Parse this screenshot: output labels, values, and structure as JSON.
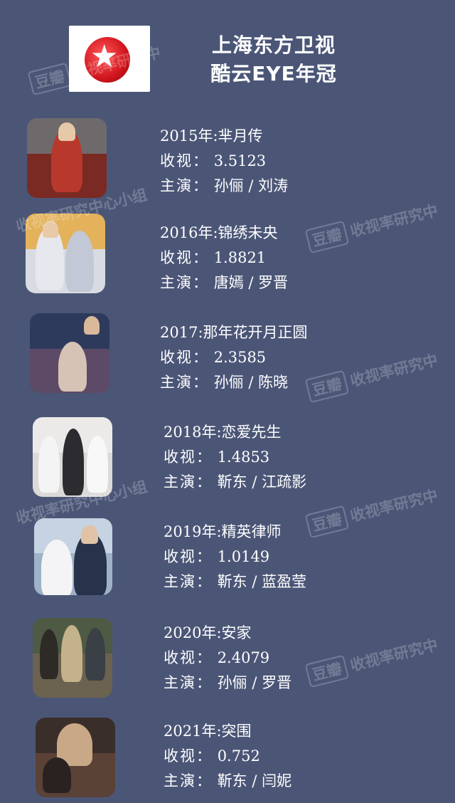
{
  "header": {
    "line1": "上海东方卫视",
    "line2": "酷云EYE年冠"
  },
  "watermark": {
    "badge": "豆瓣",
    "text": "收视率研究中",
    "text_full": "收视率研究中心小组"
  },
  "entries": [
    {
      "title": "2015年:芈月传",
      "rating_label": "收视：",
      "rating": "3.5123",
      "cast_label": "主演：",
      "cast": "孙俪 / 刘涛"
    },
    {
      "title": "2016年:锦绣未央",
      "rating_label": "收视：",
      "rating": "1.8821",
      "cast_label": "主演：",
      "cast": "唐嫣 / 罗晋"
    },
    {
      "title": "2017:那年花开月正圆",
      "rating_label": "收视：",
      "rating": "2.3585",
      "cast_label": "主演：",
      "cast": "孙俪 / 陈晓"
    },
    {
      "title": "2018年:恋爱先生",
      "rating_label": "收视：",
      "rating": "1.4853",
      "cast_label": "主演：",
      "cast": "靳东 / 江疏影"
    },
    {
      "title": "2019年:精英律师",
      "rating_label": "收视：",
      "rating": "1.0149",
      "cast_label": "主演：",
      "cast": "靳东 / 蓝盈莹"
    },
    {
      "title": "2020年:安家",
      "rating_label": "收视：",
      "rating": "2.4079",
      "cast_label": "主演：",
      "cast": "孙俪 / 罗晋"
    },
    {
      "title": "2021年:突围",
      "rating_label": "收视：",
      "rating": "0.752",
      "cast_label": "主演：",
      "cast": "靳东 / 闫妮"
    }
  ]
}
